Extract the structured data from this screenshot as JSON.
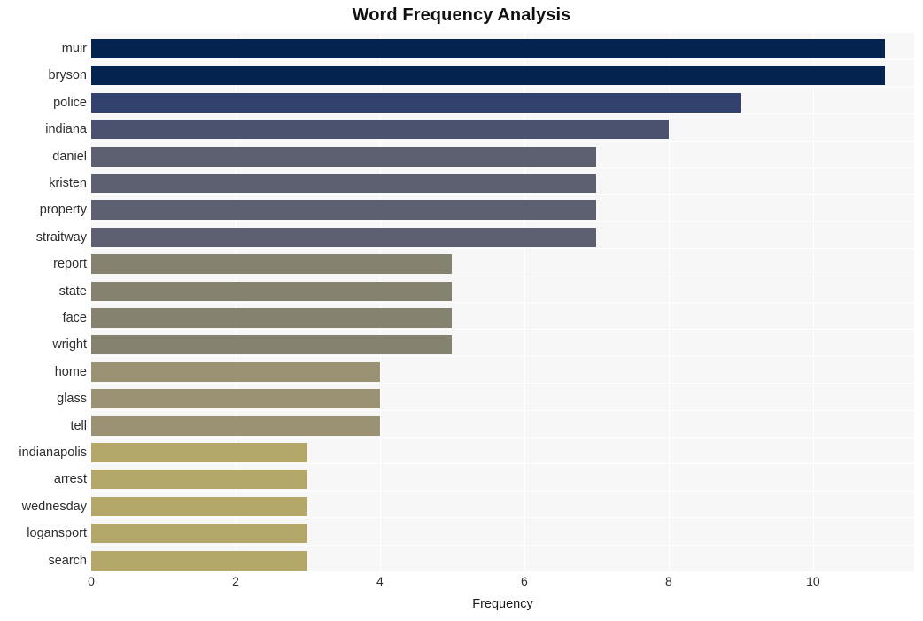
{
  "chart_data": {
    "type": "bar",
    "orientation": "horizontal",
    "title": "Word Frequency Analysis",
    "xlabel": "Frequency",
    "ylabel": "",
    "xlim": [
      0,
      11.4
    ],
    "ylim": null,
    "grid": true,
    "legend": null,
    "x_ticks": [
      0,
      2,
      4,
      6,
      8,
      10
    ],
    "x_tick_labels": [
      "0",
      "2",
      "4",
      "6",
      "8",
      "10"
    ],
    "categories": [
      "muir",
      "bryson",
      "police",
      "indiana",
      "daniel",
      "kristen",
      "property",
      "straitway",
      "report",
      "state",
      "face",
      "wright",
      "home",
      "glass",
      "tell",
      "indianapolis",
      "arrest",
      "wednesday",
      "logansport",
      "search"
    ],
    "values": [
      11,
      11,
      9,
      8,
      7,
      7,
      7,
      7,
      5,
      5,
      5,
      5,
      4,
      4,
      4,
      3,
      3,
      3,
      3,
      3
    ],
    "bar_colors": [
      "#04244f",
      "#04244f",
      "#32416e",
      "#4a5270",
      "#5d6070",
      "#5d6070",
      "#5d6070",
      "#5d6070",
      "#85826f",
      "#85826f",
      "#85826f",
      "#85826f",
      "#9a9272",
      "#9a9272",
      "#9a9272",
      "#b3a86a",
      "#b3a86a",
      "#b3a86a",
      "#b3a86a",
      "#b3a86a"
    ]
  },
  "style": {
    "page_background": "#ffffff",
    "plot_background": "#f7f7f7",
    "gridline_color": "#ffffff",
    "title_color": "#111111",
    "tick_label_color": "#2d2d2d"
  }
}
